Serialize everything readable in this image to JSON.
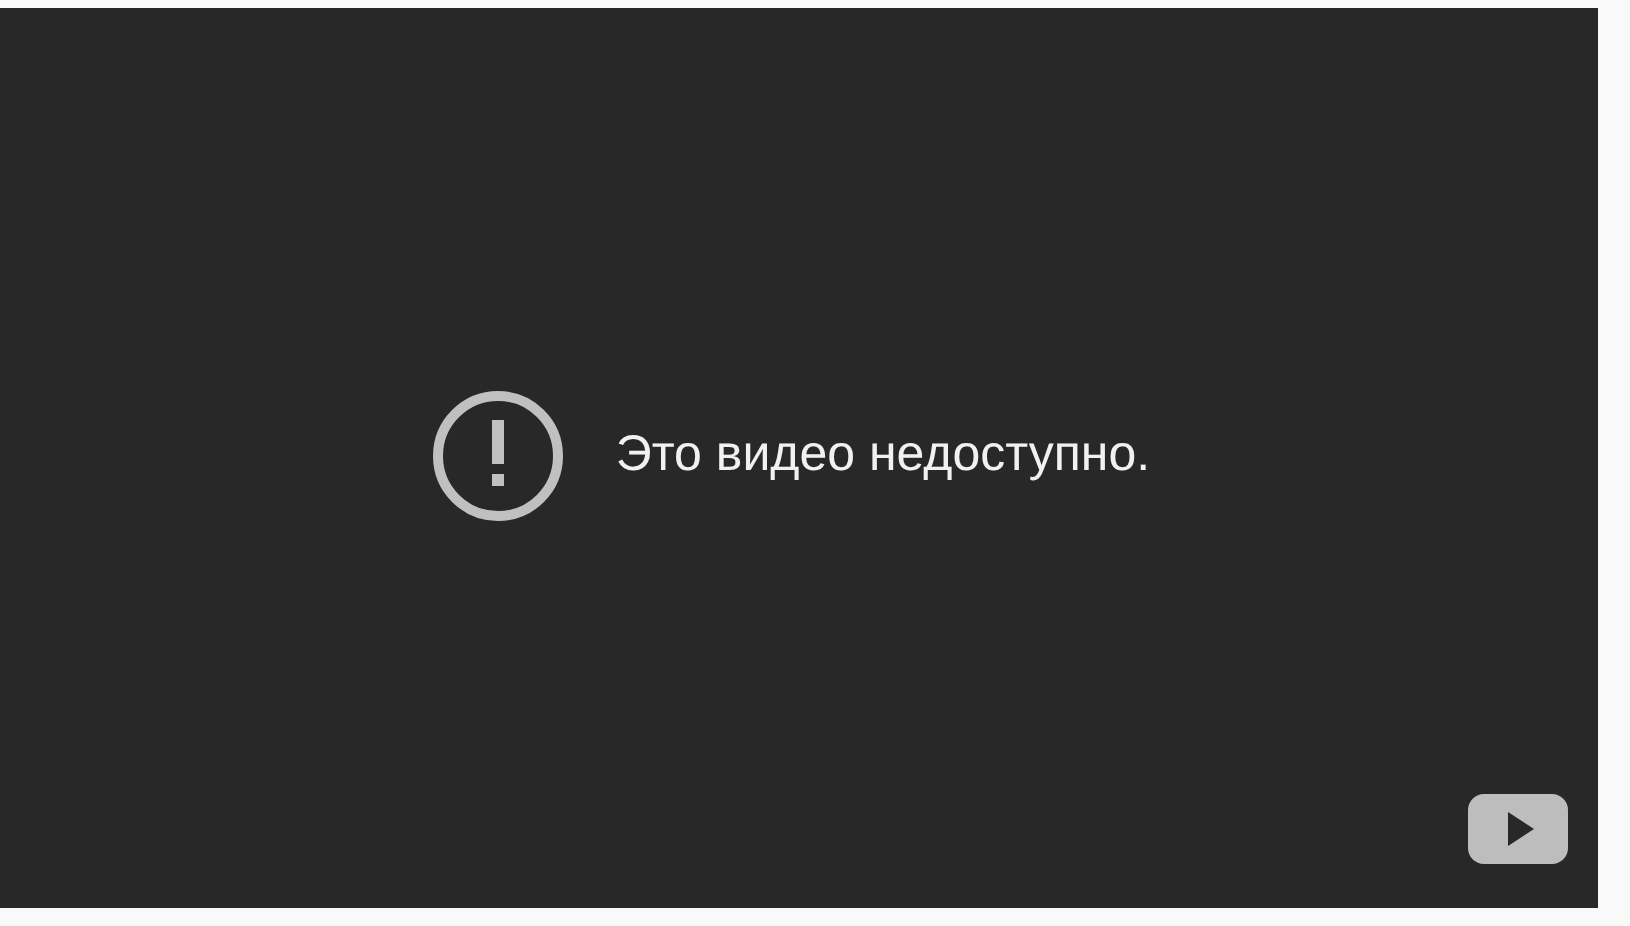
{
  "player": {
    "message": "Это видео недоступно."
  }
}
